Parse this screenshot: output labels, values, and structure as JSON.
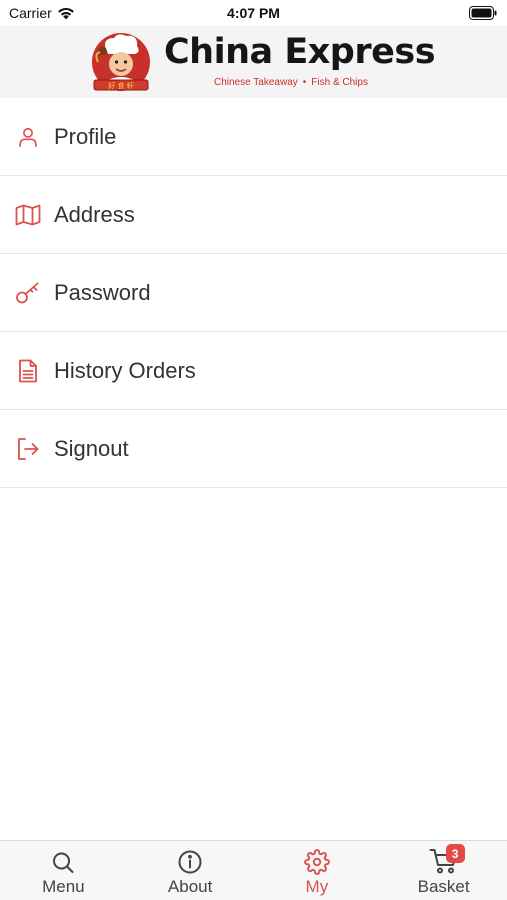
{
  "status_bar": {
    "carrier": "Carrier",
    "time": "4:07 PM"
  },
  "header": {
    "brand_title": "China Express",
    "tagline_left": "Chinese Takeaway",
    "tagline_sep": "•",
    "tagline_right": "Fish & Chips"
  },
  "menu": {
    "items": [
      {
        "label": "Profile",
        "icon": "person-icon"
      },
      {
        "label": "Address",
        "icon": "map-icon"
      },
      {
        "label": "Password",
        "icon": "key-icon"
      },
      {
        "label": "History Orders",
        "icon": "document-icon"
      },
      {
        "label": "Signout",
        "icon": "signout-icon"
      }
    ]
  },
  "tabs": [
    {
      "label": "Menu",
      "icon": "search-icon"
    },
    {
      "label": "About",
      "icon": "info-icon"
    },
    {
      "label": "My",
      "icon": "gear-icon",
      "active": true
    },
    {
      "label": "Basket",
      "icon": "cart-icon",
      "badge": "3"
    }
  ],
  "colors": {
    "accent": "#d9534f",
    "badge": "#e24b45",
    "header_bg": "#f4f4f4",
    "tabbar_bg": "#f7f7f7"
  }
}
